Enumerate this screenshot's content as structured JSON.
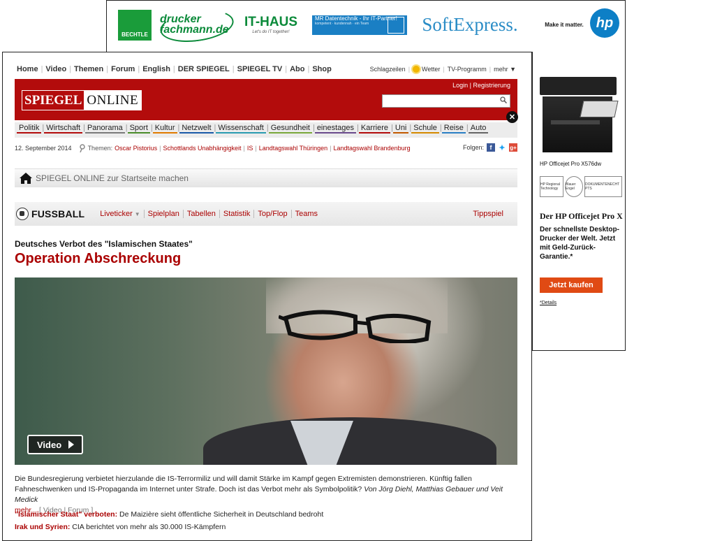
{
  "top_ad": {
    "logos": [
      "BECHTLE",
      "drucker fachmann.de",
      "IT-HAUS",
      "MR Datentechnik - Ihr IT-Partner!",
      "SoftExpress.",
      "Make it matter.",
      "hp"
    ],
    "ithaus_tag": "Let's do IT together!",
    "mr_sub": "kompetent · kundennah · ein Team"
  },
  "right_ad": {
    "product_name": "HP Officejet Pro X576dw",
    "badge1": "HP Regional Technology",
    "badge2": "Blauer Engel",
    "badge3": "DOKUMENTENECHT PTS",
    "headline": "Der HP Officejet Pro X",
    "text": "Der schnellste Desktop-Drucker der Welt. Jetzt mit Geld-Zurück-Garantie.*",
    "button": "Jetzt kaufen",
    "details": "*Details"
  },
  "service_nav": {
    "items": [
      "Home",
      "Video",
      "Themen",
      "Forum",
      "English",
      "DER SPIEGEL",
      "SPIEGEL TV",
      "Abo",
      "Shop"
    ],
    "right": {
      "schlagzeilen": "Schlagzeilen",
      "wetter": "Wetter",
      "tv": "TV-Programm",
      "mehr": "mehr ▼"
    }
  },
  "header": {
    "logo_left": "SPIEGEL",
    "logo_right": "ONLINE",
    "login": "Login | Registrierung",
    "search_placeholder": ""
  },
  "ressorts": [
    {
      "label": "Politik",
      "color": "#b30c0c"
    },
    {
      "label": "Wirtschaft",
      "color": "#b30c0c"
    },
    {
      "label": "Panorama",
      "color": "#7a7a7a"
    },
    {
      "label": "Sport",
      "color": "#4a8c2a"
    },
    {
      "label": "Kultur",
      "color": "#e07b00"
    },
    {
      "label": "Netzwelt",
      "color": "#1a5aa8"
    },
    {
      "label": "Wissenschaft",
      "color": "#2a9bb0"
    },
    {
      "label": "Gesundheit",
      "color": "#7aa83a"
    },
    {
      "label": "einestages",
      "color": "#6a4a8c"
    },
    {
      "label": "Karriere",
      "color": "#b30c0c"
    },
    {
      "label": "Uni",
      "color": "#c25a00"
    },
    {
      "label": "Schule",
      "color": "#d48a00"
    },
    {
      "label": "Reise",
      "color": "#2a7fc4"
    },
    {
      "label": "Auto",
      "color": "#666666"
    }
  ],
  "dateline": {
    "date": "12. September 2014",
    "themes_label": "Themen:",
    "topics": [
      "Oscar Pistorius",
      "Schottlands Unabhängigkeit",
      "IS",
      "Landtagswahl Thüringen",
      "Landtagswahl Brandenburg"
    ],
    "follow_label": "Folgen:"
  },
  "startpage_bar": {
    "label": "SPIEGEL ONLINE zur Startseite machen"
  },
  "fussball": {
    "title": "FUSSBALL",
    "links": [
      "Liveticker",
      "Spielplan",
      "Tabellen",
      "Statistik",
      "Top/Flop",
      "Teams"
    ],
    "tipp": "Tippspiel"
  },
  "article": {
    "kicker": "Deutsches Verbot des \"Islamischen Staates\"",
    "headline": "Operation Abschreckung",
    "video_button": "Video",
    "teaser": "Die Bundesregierung verbietet hierzulande die IS-Terrormiliz und will damit Stärke im Kampf gegen Extremisten demonstrieren. Künftig fallen Fahneschwenken und IS-Propaganda im Internet unter Strafe. Doch ist das Verbot mehr als Symbolpolitik?",
    "authors": "Von Jörg Diehl, Matthias Gebauer und Veit Medick",
    "more": "mehr...",
    "extra_links": "[ Video | Forum ]",
    "related": [
      {
        "lead": "\"Islamischer Staat\" verboten:",
        "text": "De Maizière sieht öffentliche Sicherheit in Deutschland bedroht"
      },
      {
        "lead": "Irak und Syrien:",
        "text": "CIA berichtet von mehr als 30.000 IS-Kämpfern"
      }
    ]
  }
}
